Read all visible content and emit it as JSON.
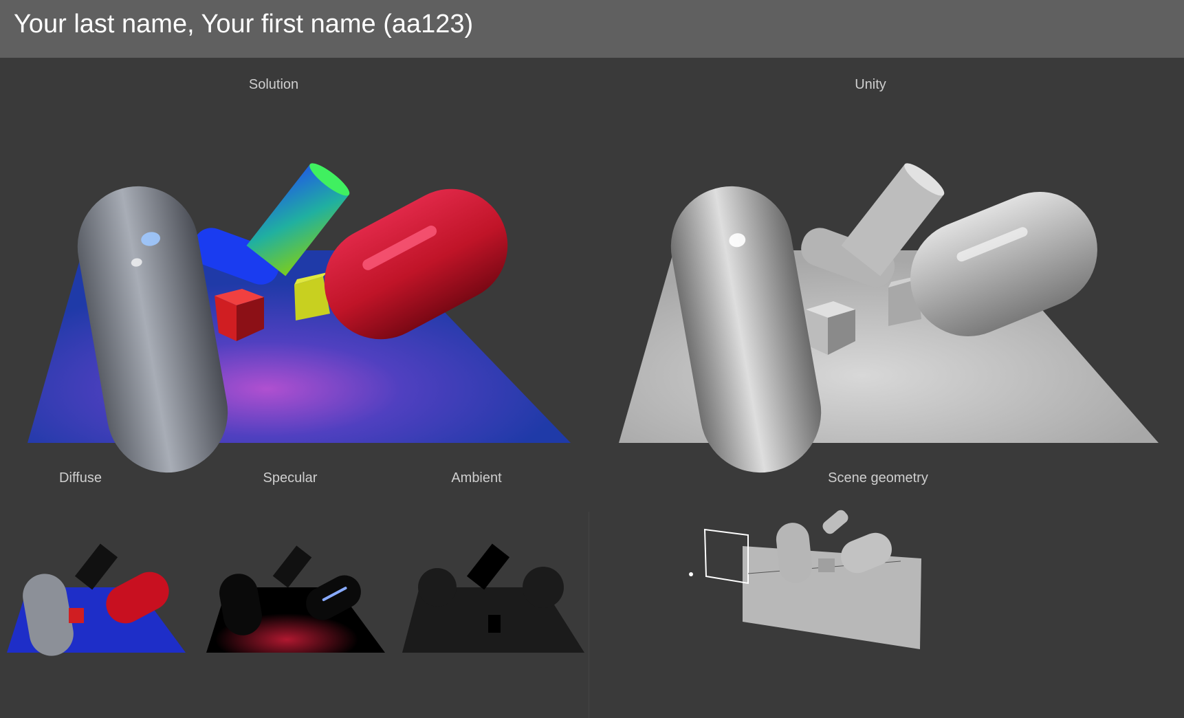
{
  "header": {
    "title": "Your last name, Your first name (aa123)"
  },
  "panels": {
    "solution_label": "Solution",
    "unity_label": "Unity",
    "diffuse_label": "Diffuse",
    "specular_label": "Specular",
    "ambient_label": "Ambient",
    "scene_geometry_label": "Scene geometry"
  },
  "colors": {
    "header_bg": "#606060",
    "page_bg": "#3a3a3a",
    "plane_blue": "#2238a0",
    "capsule_red": "#c8102e",
    "capsule_gray": "#8f949a",
    "cube_red": "#d0202a",
    "cube_yellow": "#c8d020",
    "cylinder_gradient": [
      "#30c0a0",
      "#7ad020",
      "#3050e0"
    ],
    "unity_gray": "#c4c4c4"
  }
}
